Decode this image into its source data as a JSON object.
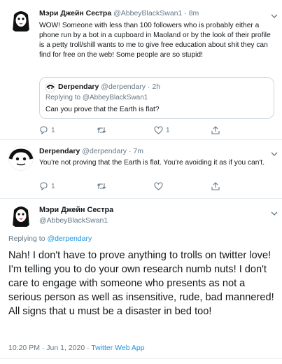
{
  "tweet1": {
    "display_name": "Мэри Джейн Сестра",
    "handle": "@AbbeyBlackSwan1",
    "time": "8m",
    "text": "WOW! Someone with less than 100 followers who is probably either a phone run by a bot in a cupboard in Maoland  or by the look of their profile is a petty troll/shill wants to me to give free education about shit they can find for free on the web! Some people are so stupid!",
    "quote": {
      "display_name": "Derpendary",
      "handle": "@derpendary",
      "time": "2h",
      "replying_label": "Replying to",
      "replying_handle": "@AbbeyBlackSwan1",
      "text": "Can you prove that the Earth is flat?"
    },
    "replies": "1",
    "retweets": "",
    "likes": "1"
  },
  "tweet2": {
    "display_name": "Derpendary",
    "handle": "@derpendary",
    "time": "7m",
    "text": "You're not proving that the Earth is flat. You're avoiding it as if you can't.",
    "replies": "1",
    "retweets": "",
    "likes": ""
  },
  "main_tweet": {
    "display_name": "Мэри Джейн Сестра",
    "handle": "@AbbeyBlackSwan1",
    "replying_label": "Replying to",
    "replying_handle": "@derpendary",
    "text": "Nah! I don't have to prove anything to trolls on twitter love! I'm telling you to do your own research numb nuts! I don't care to engage with someone who presents as not a serious person as well as insensitive, rude, bad mannered! All signs that u must be a disaster in bed too!",
    "timestamp": "10:20 PM · Jun 1, 2020 · ",
    "source": "Twitter Web App"
  },
  "colors": {
    "link": "#1b95e0",
    "muted": "#657786",
    "divider": "#e6ecf0"
  },
  "icons": [
    "nun-avatar-icon",
    "derpendary-avatar-icon",
    "reply-icon",
    "retweet-icon",
    "like-icon",
    "share-icon"
  ]
}
